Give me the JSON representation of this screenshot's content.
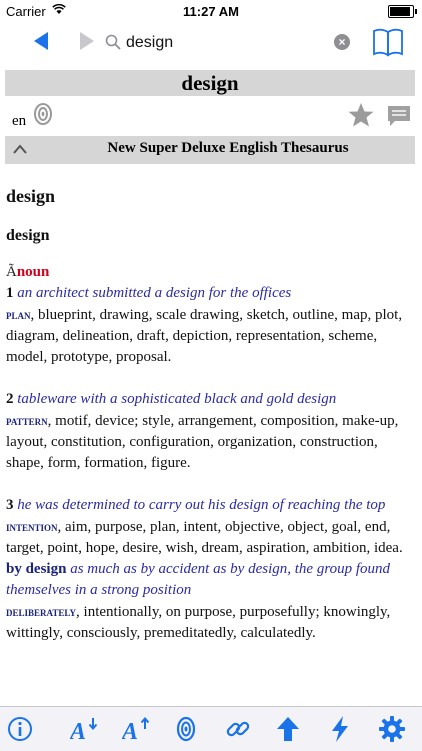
{
  "status_bar": {
    "carrier": "Carrier",
    "time": "11:27 AM"
  },
  "search": {
    "value": "design"
  },
  "entry": {
    "headword": "design",
    "language": "en"
  },
  "dictionary": {
    "title": "New Super Deluxe English Thesaurus"
  },
  "content": {
    "heading": "design",
    "subheading": "design",
    "pos_prefix": "Ã",
    "pos": "noun",
    "senses": [
      {
        "number": "1",
        "example": "an architect submitted a design for the offices",
        "keyword": "plan",
        "synonyms": ", blueprint, drawing, scale drawing, sketch, outline, map, plot, diagram, delineation, draft, depiction, representation, scheme, model, prototype, proposal."
      },
      {
        "number": "2",
        "example": "tableware with a sophisticated black and gold design",
        "keyword": "pattern",
        "synonyms": ", motif, device; style, arrangement, composition, make-up, layout, constitution, configuration, organization, construction, shape, form, formation, figure."
      },
      {
        "number": "3",
        "example": "he was determined to carry out his design of reaching the top",
        "keyword": "intention",
        "synonyms": ", aim, purpose, plan, intent, objective, object, goal, end, target, point, hope, desire, wish, dream, aspiration, ambition, idea."
      }
    ],
    "phrase": {
      "term": "by design",
      "example": "as much as by accident as by design, the group found themselves in a strong position",
      "keyword": "deliberately",
      "synonyms": ", intentionally, on purpose, purposefully; knowingly, wittingly, consciously, premeditatedly, calculatedly."
    }
  },
  "colors": {
    "accent": "#1a73e8",
    "pos": "#d0021b",
    "example": "#2a2aa8",
    "keyword": "#1a237e",
    "bar": "#d6d6d6"
  }
}
